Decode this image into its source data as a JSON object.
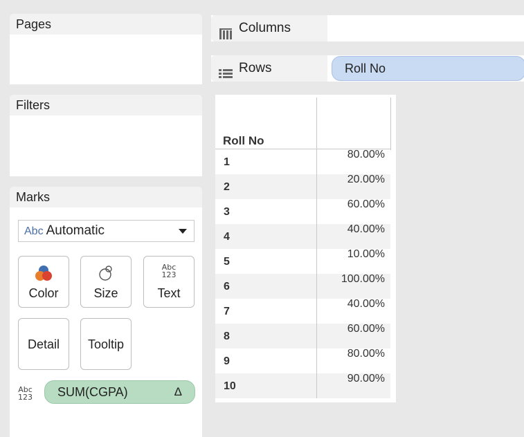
{
  "pages": {
    "title": "Pages"
  },
  "filters": {
    "title": "Filters"
  },
  "marks": {
    "title": "Marks",
    "mark_type": {
      "icon_text": "Abc",
      "value": "Automatic"
    },
    "cards": {
      "color": "Color",
      "size": "Size",
      "text": "Text",
      "detail": "Detail",
      "tooltip": "Tooltip"
    },
    "text_icon": {
      "line1": "Abc",
      "line2": "123"
    },
    "pill": {
      "label": "SUM(CGPA)",
      "delta": "Δ"
    }
  },
  "shelves": {
    "columns": {
      "label": "Columns",
      "icon": "columns-icon"
    },
    "rows": {
      "label": "Rows",
      "icon": "rows-icon",
      "pill": "Roll No"
    }
  },
  "table": {
    "header": "Roll No",
    "rows": [
      {
        "roll": "1",
        "value": "80.00%"
      },
      {
        "roll": "2",
        "value": "20.00%"
      },
      {
        "roll": "3",
        "value": "60.00%"
      },
      {
        "roll": "4",
        "value": "40.00%"
      },
      {
        "roll": "5",
        "value": "10.00%"
      },
      {
        "roll": "6",
        "value": "100.00%"
      },
      {
        "roll": "7",
        "value": "40.00%"
      },
      {
        "roll": "8",
        "value": "60.00%"
      },
      {
        "roll": "9",
        "value": "80.00%"
      },
      {
        "roll": "10",
        "value": "90.00%"
      }
    ]
  },
  "colors": {
    "rows_pill": "#c9daf3",
    "measure_pill": "#b8dcc2",
    "color_icon_blue": "#3f6fb0",
    "color_icon_orange": "#e87d2c",
    "color_icon_red": "#d9432f"
  }
}
